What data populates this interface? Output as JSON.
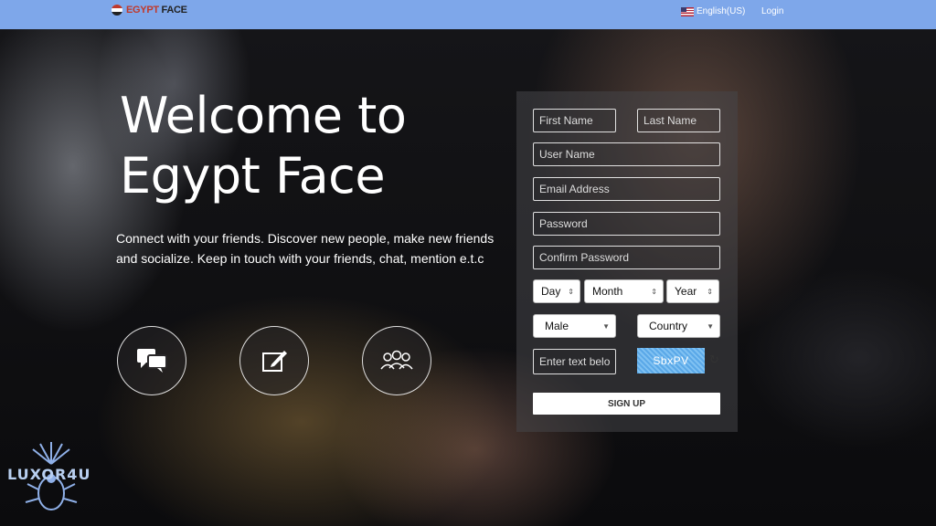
{
  "header": {
    "logo_prefix": "EGYPT",
    "logo_suffix": " FACE",
    "language": "English(US)",
    "login": "Login"
  },
  "hero": {
    "title_line1": "Welcome to",
    "title_line2": "Egypt Face",
    "tagline": "Connect with your friends. Discover new people, make new friends and socialize. Keep in touch with your friends, chat, mention e.t.c"
  },
  "form": {
    "first_name_placeholder": "First Name",
    "last_name_placeholder": "Last Name",
    "username_placeholder": "User Name",
    "email_placeholder": "Email Address",
    "password_placeholder": "Password",
    "confirm_password_placeholder": "Confirm Password",
    "day": "Day",
    "month": "Month",
    "year": "Year",
    "gender": "Male",
    "country": "Country",
    "captcha_placeholder": "Enter text below",
    "captcha_text": "SbxPV",
    "signup": "SIGN UP"
  },
  "watermark": "LUXOR4U",
  "colors": {
    "topbar": "#7ea7ea",
    "captcha": "#5aa8e8"
  }
}
